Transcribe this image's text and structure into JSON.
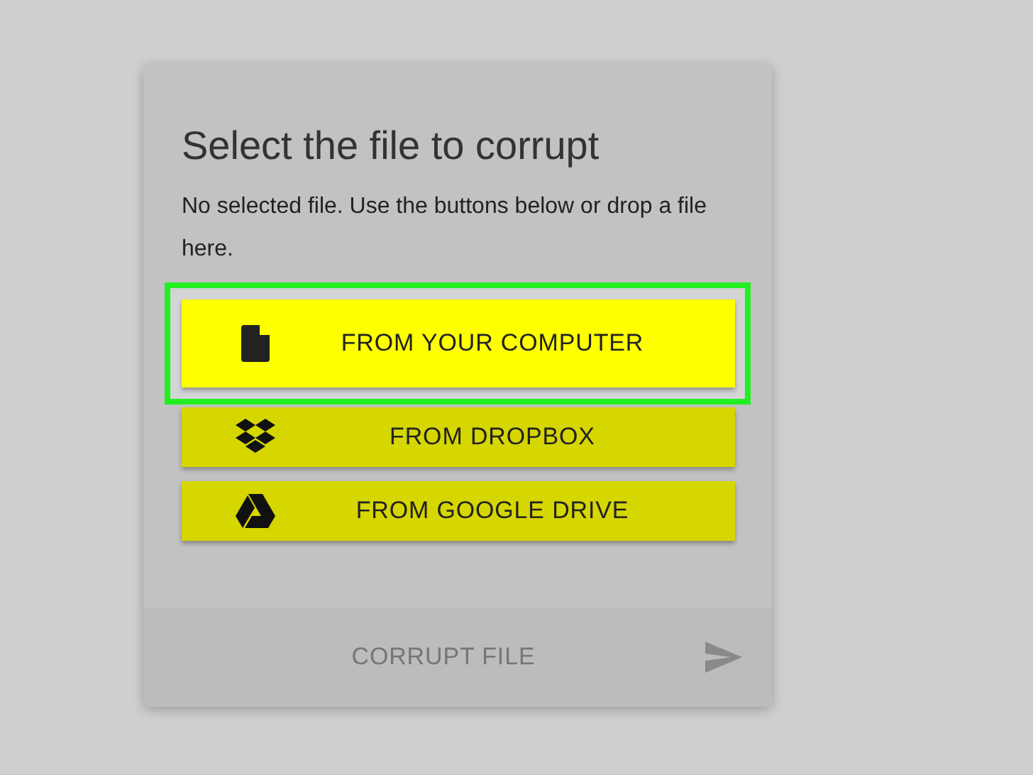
{
  "card": {
    "title": "Select the file to corrupt",
    "message": "No selected file. Use the buttons below or drop a file here.",
    "sources": [
      {
        "kind": "file",
        "label": "FROM YOUR COMPUTER",
        "highlighted": true
      },
      {
        "kind": "dropbox",
        "label": "FROM DROPBOX",
        "highlighted": false
      },
      {
        "kind": "drive",
        "label": "FROM GOOGLE DRIVE",
        "highlighted": false
      }
    ],
    "submit": {
      "label": "CORRUPT FILE",
      "disabled": true
    }
  }
}
